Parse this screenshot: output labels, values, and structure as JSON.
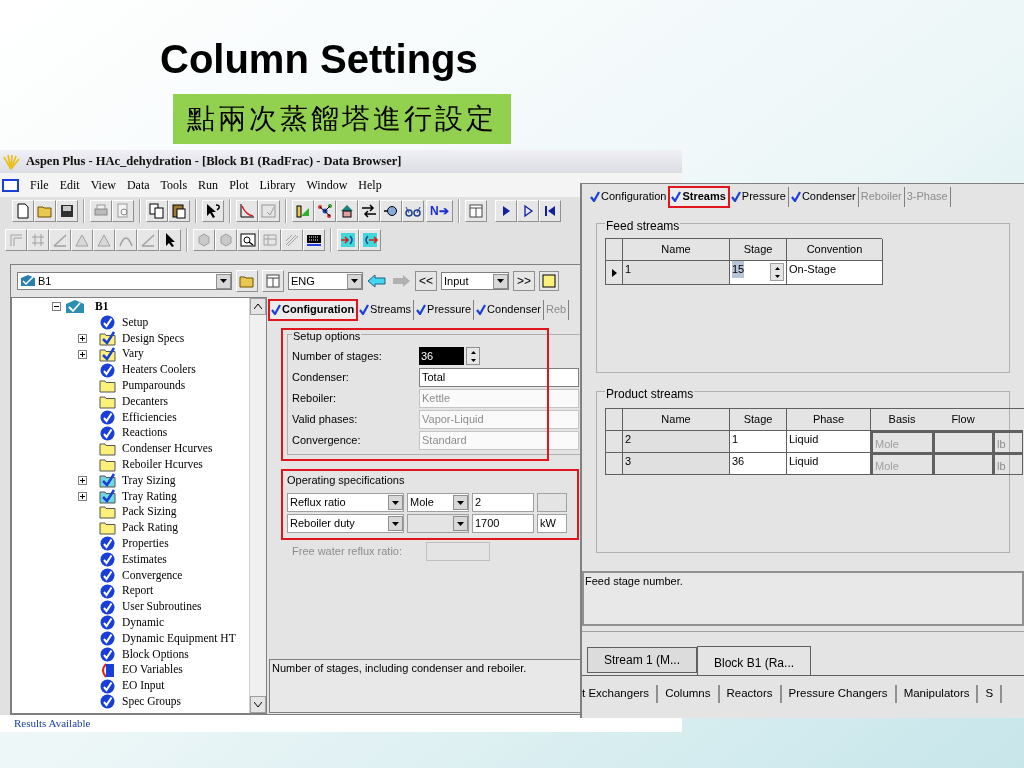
{
  "slide": {
    "title": "Column Settings",
    "subtitle": "點兩次蒸餾塔進行設定"
  },
  "main_window": {
    "title": "Aspen Plus - HAc_dehydration - [Block B1 (RadFrac) - Data Browser]",
    "menu": [
      "File",
      "Edit",
      "View",
      "Data",
      "Tools",
      "Run",
      "Plot",
      "Library",
      "Window",
      "Help"
    ],
    "toolbar_label": "N➔",
    "browser_bar": {
      "block": "B1",
      "units": "ENG",
      "back": "<<",
      "mode": "Input",
      "forward": ">>"
    },
    "tree": {
      "label": "B1",
      "expanded": true,
      "children": [
        {
          "label": "Setup",
          "kind": "done",
          "has_children": false
        },
        {
          "label": "Design Specs",
          "kind": "done_folder",
          "has_children": true
        },
        {
          "label": "Vary",
          "kind": "done_folder",
          "has_children": true
        },
        {
          "label": "Heaters Coolers",
          "kind": "done",
          "has_children": false
        },
        {
          "label": "Pumparounds",
          "kind": "folder",
          "has_children": false
        },
        {
          "label": "Decanters",
          "kind": "folder",
          "has_children": false
        },
        {
          "label": "Efficiencies",
          "kind": "done",
          "has_children": false
        },
        {
          "label": "Reactions",
          "kind": "done",
          "has_children": false
        },
        {
          "label": "Condenser Hcurves",
          "kind": "folder",
          "has_children": false
        },
        {
          "label": "Reboiler Hcurves",
          "kind": "folder",
          "has_children": false
        },
        {
          "label": "Tray Sizing",
          "kind": "results_folder",
          "has_children": true
        },
        {
          "label": "Tray Rating",
          "kind": "results_folder",
          "has_children": true
        },
        {
          "label": "Pack Sizing",
          "kind": "folder",
          "has_children": false
        },
        {
          "label": "Pack Rating",
          "kind": "folder",
          "has_children": false
        },
        {
          "label": "Properties",
          "kind": "done",
          "has_children": false
        },
        {
          "label": "Estimates",
          "kind": "done",
          "has_children": false
        },
        {
          "label": "Convergence",
          "kind": "done",
          "has_children": false
        },
        {
          "label": "Report",
          "kind": "done",
          "has_children": false
        },
        {
          "label": "User Subroutines",
          "kind": "done",
          "has_children": false
        },
        {
          "label": "Dynamic",
          "kind": "done",
          "has_children": false
        },
        {
          "label": "Dynamic Equipment HT",
          "kind": "done",
          "has_children": false
        },
        {
          "label": "Block Options",
          "kind": "done",
          "has_children": false
        },
        {
          "label": "EO Variables",
          "kind": "eo",
          "has_children": false
        },
        {
          "label": "EO Input",
          "kind": "done",
          "has_children": false
        },
        {
          "label": "Spec Groups",
          "kind": "done",
          "has_children": false
        }
      ]
    },
    "tabs": [
      {
        "label": "Configuration",
        "checked": true,
        "selected": true,
        "disabled": false,
        "highlighted": true
      },
      {
        "label": "Streams",
        "checked": true,
        "selected": false,
        "disabled": false,
        "highlighted": false
      },
      {
        "label": "Pressure",
        "checked": true,
        "selected": false,
        "disabled": false,
        "highlighted": false
      },
      {
        "label": "Condenser",
        "checked": true,
        "selected": false,
        "disabled": false,
        "highlighted": false
      },
      {
        "label": "Reb",
        "checked": false,
        "selected": false,
        "disabled": true,
        "highlighted": false
      }
    ],
    "setup_options": {
      "title": "Setup options",
      "highlighted": true,
      "fields": [
        {
          "label": "Number of stages:",
          "value": "36",
          "kind": "spinner",
          "disabled": false
        },
        {
          "label": "Condenser:",
          "value": "Total",
          "kind": "text",
          "disabled": false
        },
        {
          "label": "Reboiler:",
          "value": "Kettle",
          "kind": "text",
          "disabled": true
        },
        {
          "label": "Valid phases:",
          "value": "Vapor-Liquid",
          "kind": "text",
          "disabled": true
        },
        {
          "label": "Convergence:",
          "value": "Standard",
          "kind": "text",
          "disabled": true
        }
      ]
    },
    "operating_specs": {
      "title": "Operating specifications",
      "highlighted": true,
      "rows": [
        {
          "spec": "Reflux ratio",
          "basis": "Mole",
          "basis_disabled": false,
          "value": "2"
        },
        {
          "spec": "Reboiler duty",
          "basis_disabled": true,
          "value": "1700",
          "units": "kW"
        }
      ],
      "free_water": {
        "label": "Free water reflux ratio:",
        "disabled": true
      }
    },
    "description": "Number of stages, including condenser and reboiler.",
    "status": "Results Available"
  },
  "streams_window": {
    "tabs": [
      {
        "label": "Configuration",
        "checked": true,
        "selected": false,
        "disabled": false,
        "highlighted": false
      },
      {
        "label": "Streams",
        "checked": true,
        "selected": true,
        "disabled": false,
        "highlighted": true
      },
      {
        "label": "Pressure",
        "checked": true,
        "selected": false,
        "disabled": false,
        "highlighted": false
      },
      {
        "label": "Condenser",
        "checked": true,
        "selected": false,
        "disabled": false,
        "highlighted": false
      },
      {
        "label": "Reboiler",
        "checked": false,
        "selected": false,
        "disabled": true,
        "highlighted": false
      },
      {
        "label": "3-Phase",
        "checked": false,
        "selected": false,
        "disabled": true,
        "highlighted": false
      }
    ],
    "feed": {
      "title": "Feed streams",
      "columns": [
        "Name",
        "Stage",
        "Convention"
      ],
      "rows": [
        {
          "name": "1",
          "stage": "15",
          "convention": "On-Stage",
          "current": true
        }
      ]
    },
    "product": {
      "title": "Product streams",
      "columns": [
        "Name",
        "Stage",
        "Phase",
        "Basis",
        "Flow"
      ],
      "rows": [
        {
          "name": "2",
          "stage": "1",
          "phase": "Liquid",
          "basis": "Mole",
          "units": "lb"
        },
        {
          "name": "3",
          "stage": "36",
          "phase": "Liquid",
          "basis": "Mole",
          "units": "lb"
        }
      ]
    },
    "description": "Feed stage number.",
    "window_tabs": [
      {
        "label": "Stream 1 (M...",
        "selected": false
      },
      {
        "label": "Block B1 (Ra...",
        "selected": true
      }
    ],
    "palette_tabs": [
      "t Exchangers",
      "Columns",
      "Reactors",
      "Pressure Changers",
      "Manipulators",
      "S"
    ]
  }
}
